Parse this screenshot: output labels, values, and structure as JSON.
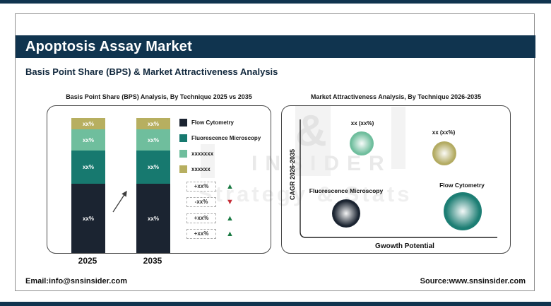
{
  "brand": {
    "navy": "#10344f"
  },
  "header": {
    "title": "Apoptosis Assay Market",
    "subtitle": "Basis Point Share (BPS) & Market Attractiveness Analysis"
  },
  "footer": {
    "email": "Email:info@snsinsider.com",
    "source": "Source:www.snsinsider.com"
  },
  "watermark": {
    "amp": "&",
    "line1": "INSIDER",
    "line2": "Strategy & Stats"
  },
  "bps_chart": {
    "title": "Basis Point Share (BPS) Analysis, By Technique 2025 vs 2035",
    "years": [
      "2025",
      "2035"
    ],
    "legend": [
      {
        "label": "Flow Cytometry",
        "color": "#1b2431"
      },
      {
        "label": "Fluorescence Microscopy",
        "color": "#17796f"
      },
      {
        "label": "xxxxxxx",
        "color": "#6fbe9d"
      },
      {
        "label": "xxxxxx",
        "color": "#b7af60"
      }
    ],
    "bars": [
      {
        "year": "2025",
        "segments": [
          {
            "label": "xx%"
          },
          {
            "label": "xx%"
          },
          {
            "label": "xx%"
          },
          {
            "label": "xx%"
          }
        ]
      },
      {
        "year": "2035",
        "segments": [
          {
            "label": "xx%"
          },
          {
            "label": "xx%"
          },
          {
            "label": "xx%"
          },
          {
            "label": "xx%"
          }
        ]
      }
    ],
    "changes": [
      {
        "label": "+xx%",
        "glyph": "▲",
        "color": "#1a7a43"
      },
      {
        "label": "-xx%",
        "glyph": "▼",
        "color": "#c62f39"
      },
      {
        "label": "+xx%",
        "glyph": "▲",
        "color": "#1a7a43"
      },
      {
        "label": "+xx%",
        "glyph": "▲",
        "color": "#1a7a43"
      }
    ]
  },
  "attractiveness_chart": {
    "title": "Market Attractiveness Analysis, By Technique 2026-2035",
    "y_axis": "CAGR 2026-2035",
    "x_axis": "Gwowth Potential",
    "bubbles": [
      {
        "label": "xx (xx%)",
        "color": "#6fbe9d"
      },
      {
        "label": "xx (xx%)",
        "color": "#b3ab62"
      },
      {
        "label": "Fluorescence Microscopy",
        "color": "#1b2431"
      },
      {
        "label": "Flow Cytometry",
        "color": "#1d7e74"
      }
    ]
  },
  "chart_data": [
    {
      "type": "bar",
      "title": "Basis Point Share (BPS) Analysis, By Technique 2025 vs 2035",
      "categories": [
        "2025",
        "2035"
      ],
      "stacked": true,
      "series": [
        {
          "name": "Flow Cytometry",
          "values": [
            "xx%",
            "xx%"
          ],
          "visual_share_pct": [
            52,
            52
          ],
          "color": "#1b2431"
        },
        {
          "name": "Fluorescence Microscopy",
          "values": [
            "xx%",
            "xx%"
          ],
          "visual_share_pct": [
            24,
            24
          ],
          "color": "#17796f"
        },
        {
          "name": "xxxxxxx",
          "values": [
            "xx%",
            "xx%"
          ],
          "visual_share_pct": [
            16,
            16
          ],
          "color": "#6fbe9d"
        },
        {
          "name": "xxxxxx",
          "values": [
            "xx%",
            "xx%"
          ],
          "visual_share_pct": [
            8,
            8
          ],
          "color": "#b7af60"
        }
      ],
      "annotations": [
        "+xx%",
        "-xx%",
        "+xx%",
        "+xx%"
      ],
      "note": "all values shown as xx% placeholders in source image"
    },
    {
      "type": "scatter",
      "title": "Market Attractiveness Analysis, By Technique 2026-2035",
      "xlabel": "Gwowth Potential",
      "ylabel": "CAGR 2026-2035",
      "grid": false,
      "points": [
        {
          "label": "xx (xx%)",
          "x": 0.31,
          "y": 0.8,
          "radius_px": 17,
          "color": "#6fbe9d"
        },
        {
          "label": "xx (xx%)",
          "x": 0.73,
          "y": 0.71,
          "radius_px": 17,
          "color": "#b3ab62"
        },
        {
          "label": "Fluorescence Microscopy",
          "x": 0.23,
          "y": 0.2,
          "radius_px": 20,
          "color": "#1b2431"
        },
        {
          "label": "Flow Cytometry",
          "x": 0.82,
          "y": 0.22,
          "radius_px": 27,
          "color": "#1d7e74"
        }
      ]
    }
  ]
}
